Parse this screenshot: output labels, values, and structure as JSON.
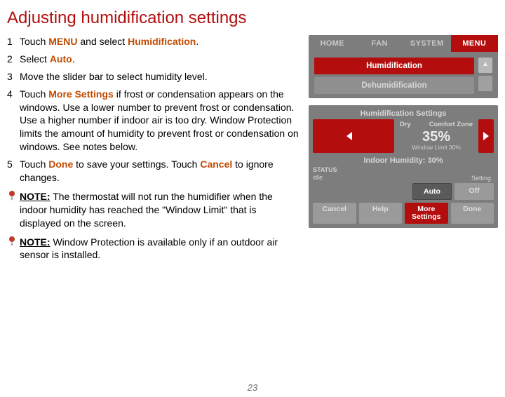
{
  "title": "Adjusting humidification settings",
  "steps": {
    "s1": {
      "pre": "Touch ",
      "kw1": "MENU",
      "mid": " and select ",
      "kw2": "Humidification",
      "post": "."
    },
    "s2": {
      "pre": "Select ",
      "kw1": "Auto",
      "post": "."
    },
    "s3": {
      "text": "Move the slider bar to select humidity level."
    },
    "s4": {
      "pre": "Touch ",
      "kw1": "More Settings",
      "post": " if frost or condensation appears on the windows. Use a lower number to prevent frost or condensation. Use a higher number if indoor air is too dry. Window Protection limits the amount of humidity to prevent frost or condensation on windows. See notes below."
    },
    "s5": {
      "pre": "Touch ",
      "kw1": "Done",
      "mid": " to save your settings. Touch ",
      "kw2": "Cancel",
      "post": " to ignore changes."
    }
  },
  "notes": {
    "n1": {
      "label": "NOTE:",
      "text": " The thermostat will not run the humidifier when the indoor humidity has reached the \"Window Limit\" that is displayed on the screen."
    },
    "n2": {
      "label": "NOTE:",
      "text": " Window Protection is available only if an outdoor air sensor is installed."
    }
  },
  "page_number": "23",
  "shot1": {
    "tabs": {
      "home": "HOME",
      "fan": "FAN",
      "system": "SYSTEM",
      "menu": "MENU"
    },
    "menu": {
      "humid": "Humidification",
      "dehumid": "Dehumidification"
    },
    "scroll_up": "▲"
  },
  "shot2": {
    "title": "Humidification Settings",
    "dry": "Dry",
    "comfort": "Comfort Zone",
    "value": "35%",
    "window_limit": "Window Limit 30%",
    "indoor": "Indoor Humidity: 30%",
    "status_label": "STATUS",
    "status_value": "idle",
    "setting_label": "Setting",
    "mode_auto": "Auto",
    "mode_off": "Off",
    "btn_cancel": "Cancel",
    "btn_help": "Help",
    "btn_more1": "More",
    "btn_more2": "Settings",
    "btn_done": "Done"
  }
}
